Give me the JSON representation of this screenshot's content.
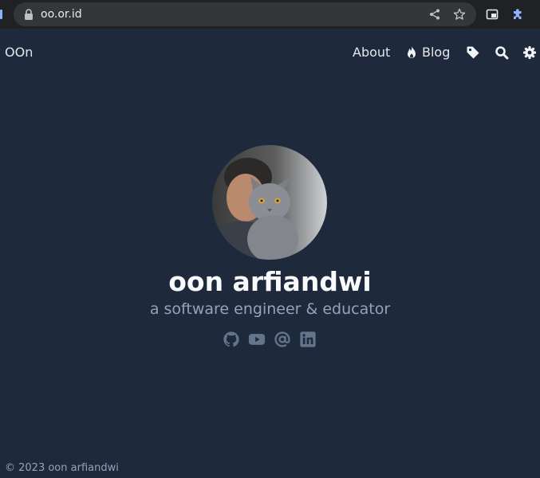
{
  "browser": {
    "url": "oo.or.id",
    "icons": [
      "lock-icon",
      "share-icon",
      "star-icon",
      "picture-in-picture-icon",
      "extensions-puzzle-icon"
    ]
  },
  "site": {
    "logo": "OOn",
    "nav": {
      "about_label": "About",
      "blog_label": "Blog",
      "icons": [
        "fire-icon",
        "tag-icon",
        "search-icon",
        "gear-icon"
      ]
    }
  },
  "hero": {
    "name": "oon arfiandwi",
    "tagline": "a software engineer & educator",
    "social_icons": [
      "github-icon",
      "youtube-icon",
      "email-at-icon",
      "linkedin-icon"
    ]
  },
  "footer": {
    "copyright": "© 2023 oon arfiandwi"
  },
  "colors": {
    "page_background": "#1e293b",
    "browser_bar": "#202124",
    "omnibox": "#35363a",
    "muted_text": "#94a3b8",
    "social_icon": "#64748b",
    "accent_blue": "#8ab4f8"
  }
}
